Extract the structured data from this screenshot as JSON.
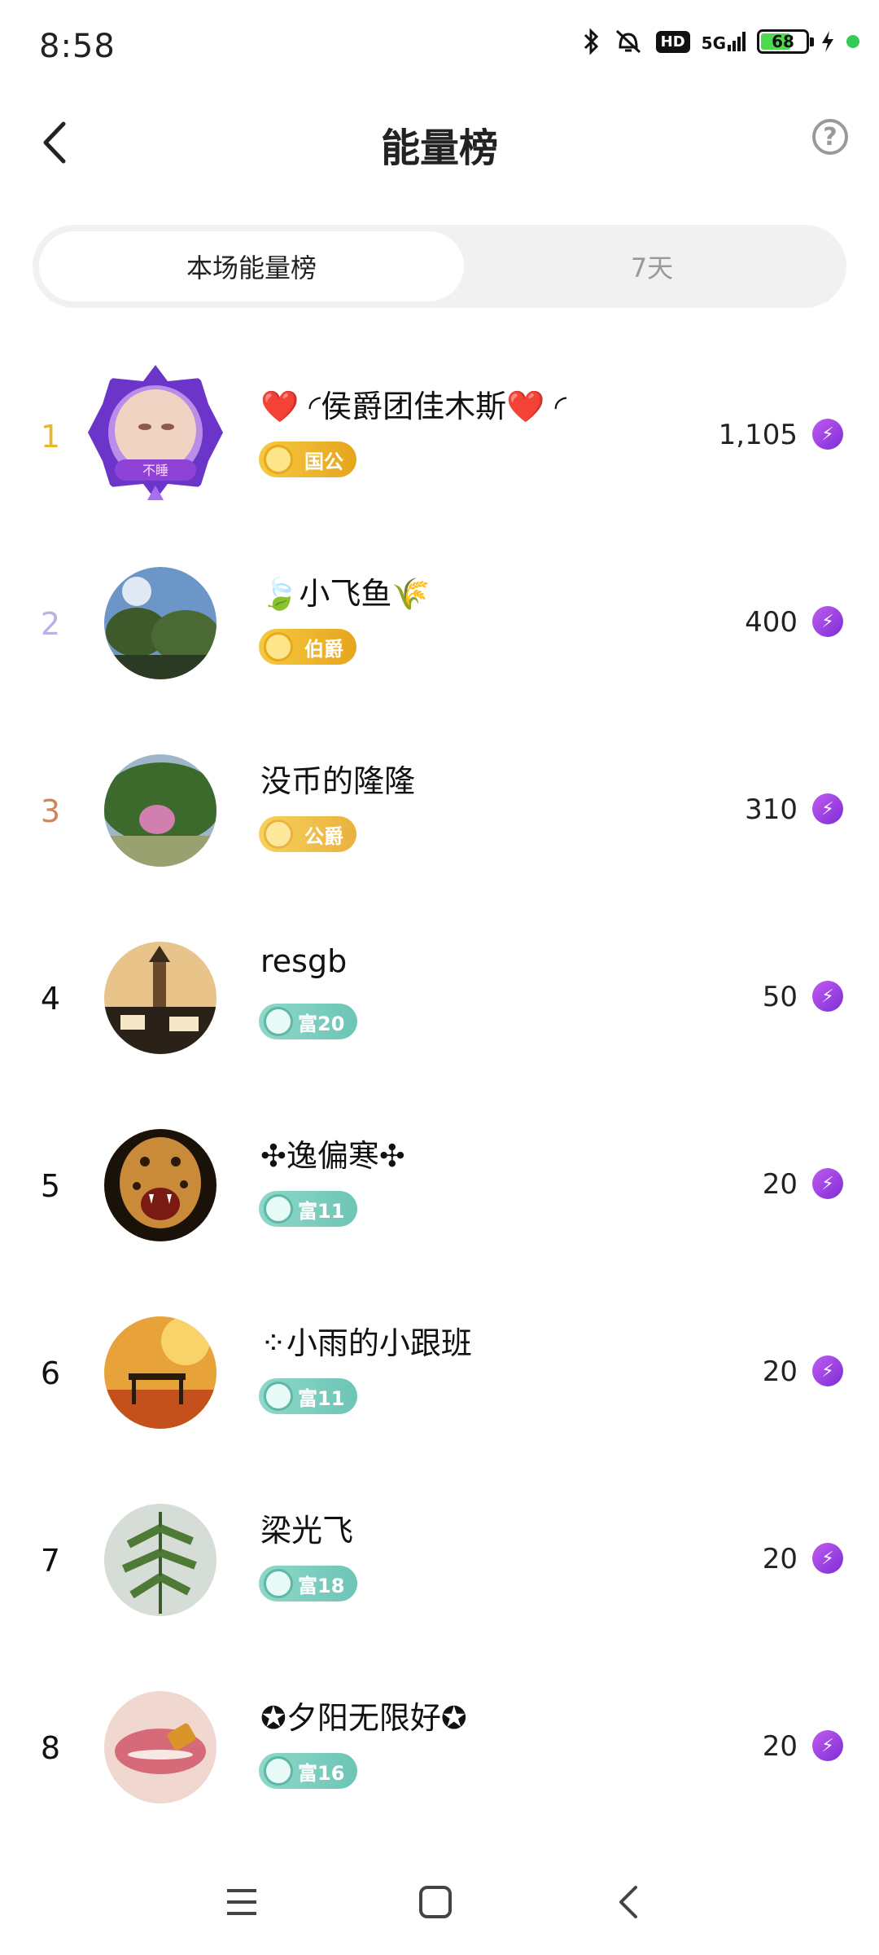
{
  "status_bar": {
    "time": "8:58",
    "signal_label": "5G",
    "hd_label": "HD",
    "battery": "68"
  },
  "header": {
    "title": "能量榜",
    "help_icon": "question-circle-icon",
    "back_icon": "chevron-left-icon"
  },
  "tabs": [
    {
      "label": "本场能量榜",
      "active": true
    },
    {
      "label": "7天",
      "active": false
    }
  ],
  "ranking": [
    {
      "rank": "1",
      "name": "❤️ ◜侯爵团佳木斯❤️ ◜",
      "badge": "国公",
      "badge_style": "gold",
      "score": "1,105",
      "rank_color": "#e8b72c"
    },
    {
      "rank": "2",
      "name": "🍃小飞鱼🌾",
      "badge": "伯爵",
      "badge_style": "gold",
      "score": "400",
      "rank_color": "#b6b2e6"
    },
    {
      "rank": "3",
      "name": "没币的隆隆",
      "badge": "公爵",
      "badge_style": "gold",
      "score": "310",
      "rank_color": "#d2845b"
    },
    {
      "rank": "4",
      "name": "resgb",
      "badge": "富20",
      "badge_style": "teal",
      "score": "50",
      "rank_color": "#222222"
    },
    {
      "rank": "5",
      "name": "✣逸偏寒✣",
      "badge": "富11",
      "badge_style": "teal",
      "score": "20",
      "rank_color": "#222222"
    },
    {
      "rank": "6",
      "name": "⁘小雨的小跟班",
      "badge": "富11",
      "badge_style": "teal",
      "score": "20",
      "rank_color": "#222222"
    },
    {
      "rank": "7",
      "name": "梁光飞",
      "badge": "富18",
      "badge_style": "teal",
      "score": "20",
      "rank_color": "#222222"
    },
    {
      "rank": "8",
      "name": "✪夕阳无限好✪",
      "badge": "富16",
      "badge_style": "teal",
      "score": "20",
      "rank_color": "#222222"
    }
  ],
  "colors": {
    "accent_purple": "#8a3ee0",
    "gold_badge": "#f0b82c",
    "teal_badge": "#7dcfbf"
  },
  "nav": [
    "menu-icon",
    "home-square-icon",
    "back-triangle-icon"
  ]
}
